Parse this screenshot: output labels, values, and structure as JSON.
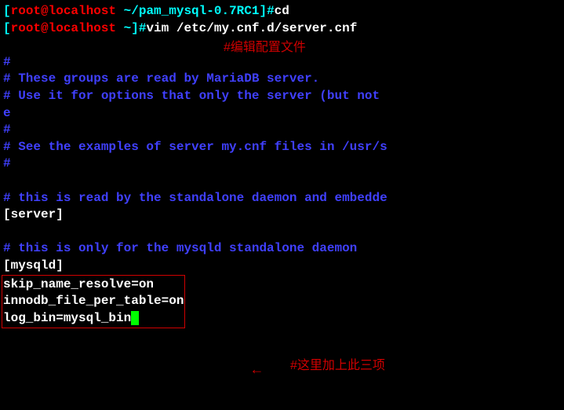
{
  "prompt1": {
    "open": "[",
    "user": "root@localhost ",
    "path": "~/pam_mysql-0.7RC1",
    "close": "]#",
    "cmd": "cd"
  },
  "prompt2": {
    "open": "[",
    "user": "root@localhost ",
    "path": "~",
    "close": "]#",
    "cmd": "vim /etc/my.cnf.d/server.cnf"
  },
  "annotation1": "#编辑配置文件",
  "file": {
    "l1": "#",
    "l2": "# These groups are read by MariaDB server.",
    "l3": "# Use it for options that only the server (but not ",
    "l3b": "e",
    "l4": "#",
    "l5": "# See the examples of server my.cnf files in /usr/s",
    "l6": "#",
    "l7": "",
    "l8": "# this is read by the standalone daemon and embedde",
    "l9": "[server]",
    "l10": "",
    "l11": "# this is only for the mysqld standalone daemon",
    "l12": "[mysqld]",
    "l13": "skip_name_resolve=on",
    "l14": "innodb_file_per_table=on",
    "l15": "log_bin=mysql_bin"
  },
  "annotation2": "#这里加上此三项",
  "arrow": "←"
}
